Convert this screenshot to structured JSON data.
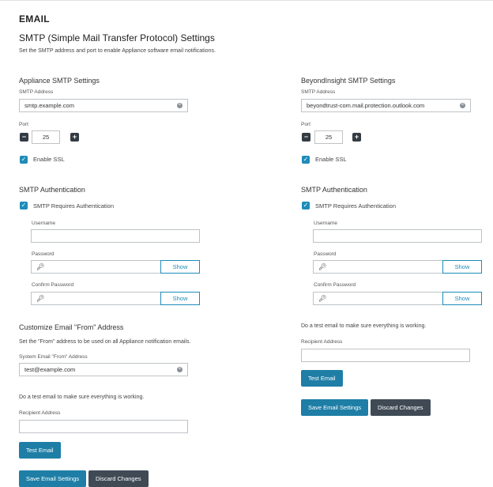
{
  "page": {
    "title": "EMAIL",
    "section_title": "SMTP (Simple Mail Transfer Protocol) Settings",
    "section_desc": "Set the SMTP address and port to enable Appliance software email notifications."
  },
  "appliance": {
    "heading": "Appliance SMTP Settings",
    "smtp_address_label": "SMTP Address",
    "smtp_address_value": "smtp.example.com",
    "port_label": "Port",
    "port_value": "25",
    "ssl_label": "Enable SSL",
    "ssl_checked": true,
    "auth_heading": "SMTP Authentication",
    "auth_required_label": "SMTP Requires Authentication",
    "username_label": "Username",
    "password_label": "Password",
    "confirm_password_label": "Confirm Password",
    "show_label": "Show",
    "from_heading": "Customize Email \"From\" Address",
    "from_desc": "Set the \"From\" address to be used on all Appliance notification emails.",
    "from_label": "System Email \"From\" Address",
    "from_value": "test@example.com",
    "test_desc": "Do a test email to make sure everything is working.",
    "recipient_label": "Recipient Address",
    "test_button": "Test Email",
    "save_button": "Save Email Settings",
    "discard_button": "Discard Changes"
  },
  "beyondinsight": {
    "heading": "BeyondInsight SMTP Settings",
    "smtp_address_label": "SMTP Address",
    "smtp_address_value": "beyondtrust-com.mail.protection.outlook.com",
    "port_label": "Port",
    "port_value": "25",
    "ssl_label": "Enable SSL",
    "ssl_checked": true,
    "auth_heading": "SMTP Authentication",
    "auth_required_label": "SMTP Requires Authentication",
    "username_label": "Username",
    "password_label": "Password",
    "confirm_password_label": "Confirm Password",
    "show_label": "Show",
    "test_desc": "Do a test email to make sure everything is working.",
    "recipient_label": "Recipient Address",
    "test_button": "Test Email",
    "save_button": "Save Email Settings",
    "discard_button": "Discard Changes"
  },
  "icons": {
    "minus": "minus-icon",
    "plus": "plus-icon",
    "check": "check-icon",
    "key": "key-icon",
    "clear": "clear-icon"
  },
  "colors": {
    "accent": "#1e8cb9",
    "primary_button": "#1e7ea6",
    "dark_button": "#3f4a55",
    "stepper": "#333b43"
  }
}
